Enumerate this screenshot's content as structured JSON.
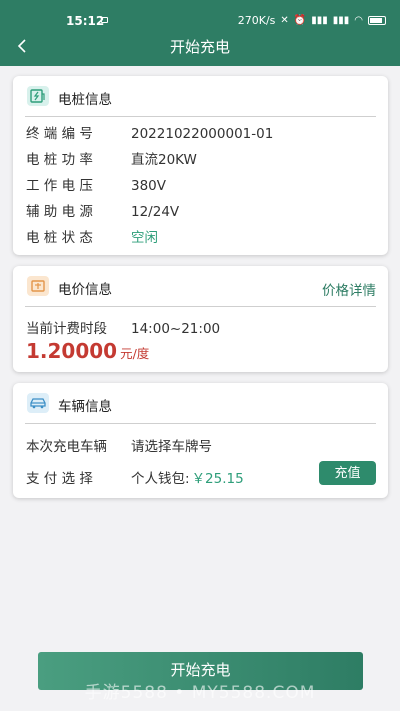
{
  "status_bar": {
    "time": "15:12",
    "net_speed": "270K/s"
  },
  "header": {
    "title": "开始充电"
  },
  "pile_info": {
    "title": "电桩信息",
    "rows": [
      {
        "label": "终 端 编 号",
        "value": "20221022000001-01"
      },
      {
        "label": "电 桩 功 率",
        "value": "直流20KW"
      },
      {
        "label": "工 作 电 压",
        "value": "380V"
      },
      {
        "label": "辅 助 电 源",
        "value": "12/24V"
      },
      {
        "label": "电 桩 状 态",
        "value": "空闲"
      }
    ]
  },
  "price_info": {
    "title": "电价信息",
    "detail_link": "价格详情",
    "period_label": "当前计费时段",
    "period_value": "14:00~21:00",
    "price": "1.20000",
    "unit": "元/度"
  },
  "vehicle_info": {
    "title": "车辆信息",
    "vehicle_label": "本次充电车辆",
    "vehicle_value": "请选择车牌号",
    "payment_label": "支 付 选 择",
    "payment_prefix": "个人钱包:",
    "payment_amount": "￥25.15",
    "recharge_label": "充值"
  },
  "footer": {
    "start_button": "开始充电",
    "watermark": "手游5588 • MY5588.COM"
  },
  "colors": {
    "brand": "#2e7d64",
    "accent_green": "#2e9e7a",
    "price_red": "#c43a32"
  }
}
